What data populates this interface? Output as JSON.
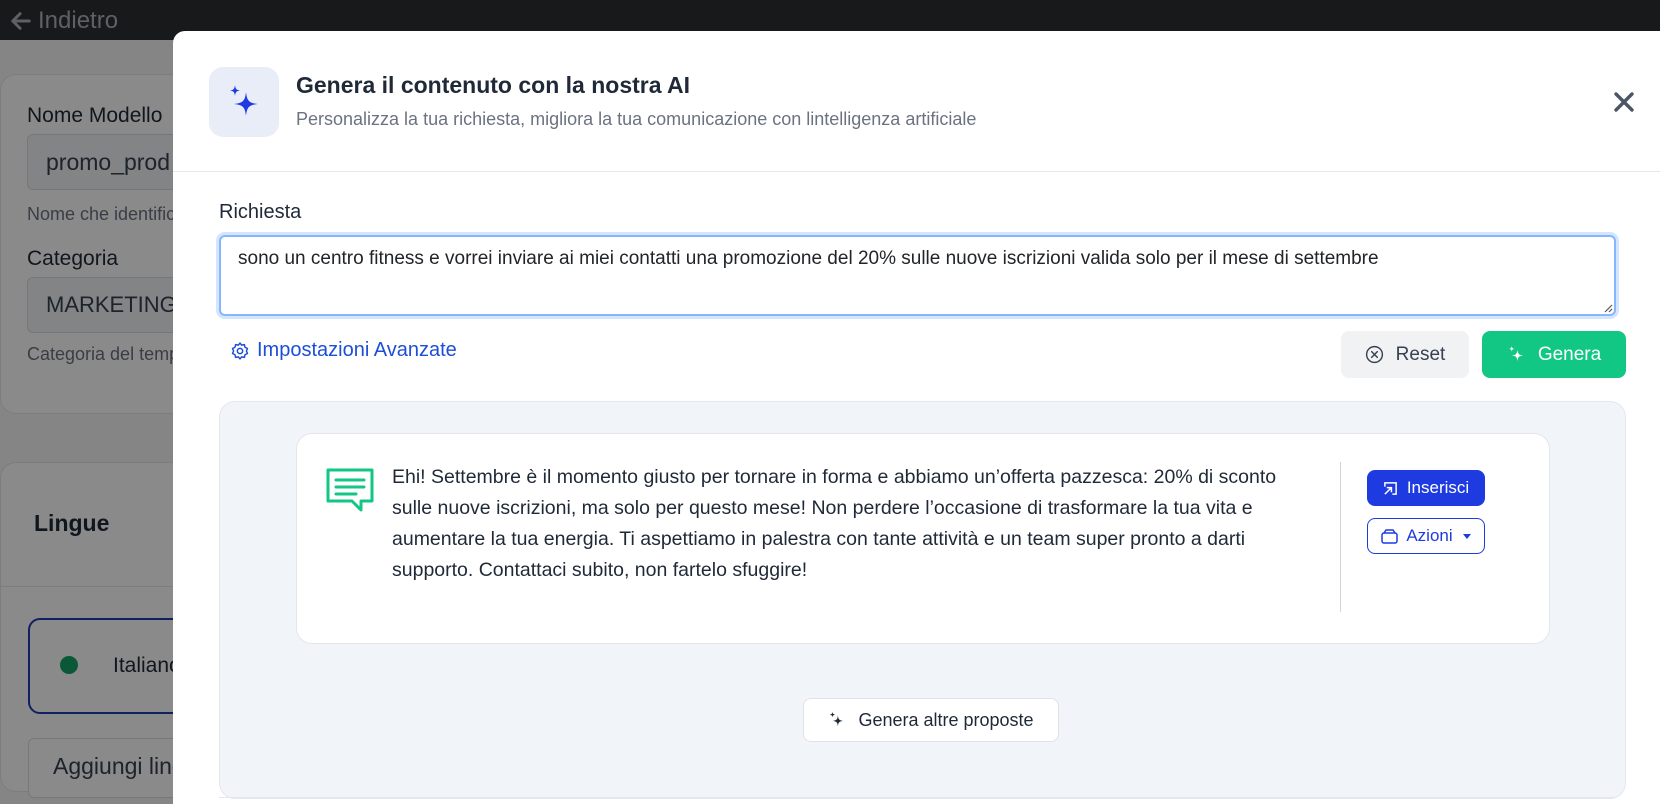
{
  "background": {
    "back_label": "Indietro",
    "model_name_label": "Nome Modello",
    "model_name_value": "promo_prod",
    "model_name_help": "Nome che identifica",
    "category_label": "Categoria",
    "category_value": "MARKETING",
    "category_help": "Categoria del template",
    "languages_title": "Lingue",
    "language_item": "Italiano",
    "add_language": "Aggiungi lingua"
  },
  "modal": {
    "title": "Genera il contenuto con la nostra AI",
    "subtitle": "Personalizza la tua richiesta, migliora la tua comunicazione con lintelligenza artificiale",
    "request_label": "Richiesta",
    "request_value": "sono un centro fitness e vorrei inviare ai miei contatti una promozione del 20% sulle nuove iscrizioni valida solo per il mese di settembre",
    "advanced_settings": "Impostazioni Avanzate",
    "reset_label": "Reset",
    "generate_label": "Genera",
    "proposals": [
      {
        "text": "Ehi! Settembre è il momento giusto per tornare in forma e abbiamo un’offerta pazzesca: 20% di sconto sulle nuove iscrizioni, ma solo per questo mese! Non perdere l’occasione di trasformare la tua vita e aumentare la tua energia. Ti aspettiamo in palestra con tante attività e un team super pronto a darti supporto. Contattaci subito, non fartelo sfuggire!",
        "insert_label": "Inserisci",
        "actions_label": "Azioni"
      }
    ],
    "more_proposals_label": "Genera altre proposte"
  },
  "colors": {
    "primary": "#1d3be0",
    "success": "#12c784",
    "link": "#1d4ed8",
    "topbar": "#2b2f33"
  },
  "icons": {
    "back": "arrow-left-icon",
    "ai": "sparkles-icon",
    "close": "close-icon",
    "settings": "gear-icon",
    "reset": "x-circle-icon",
    "message": "chat-lines-icon",
    "insert": "insert-icon",
    "actions": "wallet-icon"
  }
}
